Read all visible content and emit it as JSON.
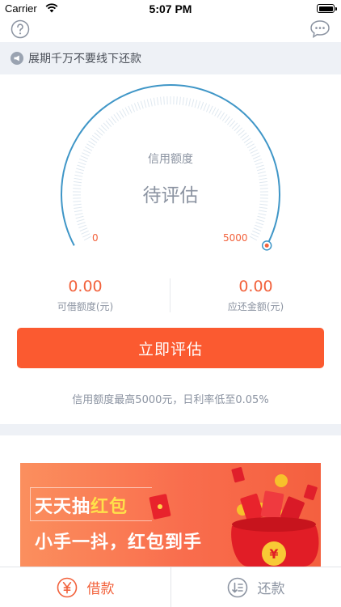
{
  "status_bar": {
    "carrier": "Carrier",
    "time": "5:07 PM"
  },
  "top_nav": {
    "help_icon": "question-circle-icon",
    "message_icon": "chat-bubble-icon"
  },
  "notice": {
    "icon": "megaphone-icon",
    "text": "展期千万不要线下还款"
  },
  "gauge": {
    "title": "信用额度",
    "value_text": "待评估",
    "min_label": "0",
    "max_label": "5000",
    "progress_fraction": 1.0,
    "arc_color": "#3f96c7",
    "indicator_color": "#f2613b"
  },
  "amounts": {
    "available": {
      "value": "0.00",
      "label": "可借额度(元)"
    },
    "due": {
      "value": "0.00",
      "label": "应还金额(元)"
    }
  },
  "primary_button": {
    "label": "立即评估",
    "color": "#fb5a30"
  },
  "hint": "信用额度最高5000元，日利率低至0.05%",
  "banner": {
    "line1_prefix": "天天抽",
    "line1_highlight": "红包",
    "line2": "小手一抖，红包到手"
  },
  "tabbar": {
    "tabs": [
      {
        "label": "借款",
        "icon": "yuan-circle-icon",
        "active": true
      },
      {
        "label": "还款",
        "icon": "repay-list-icon",
        "active": false
      }
    ]
  }
}
